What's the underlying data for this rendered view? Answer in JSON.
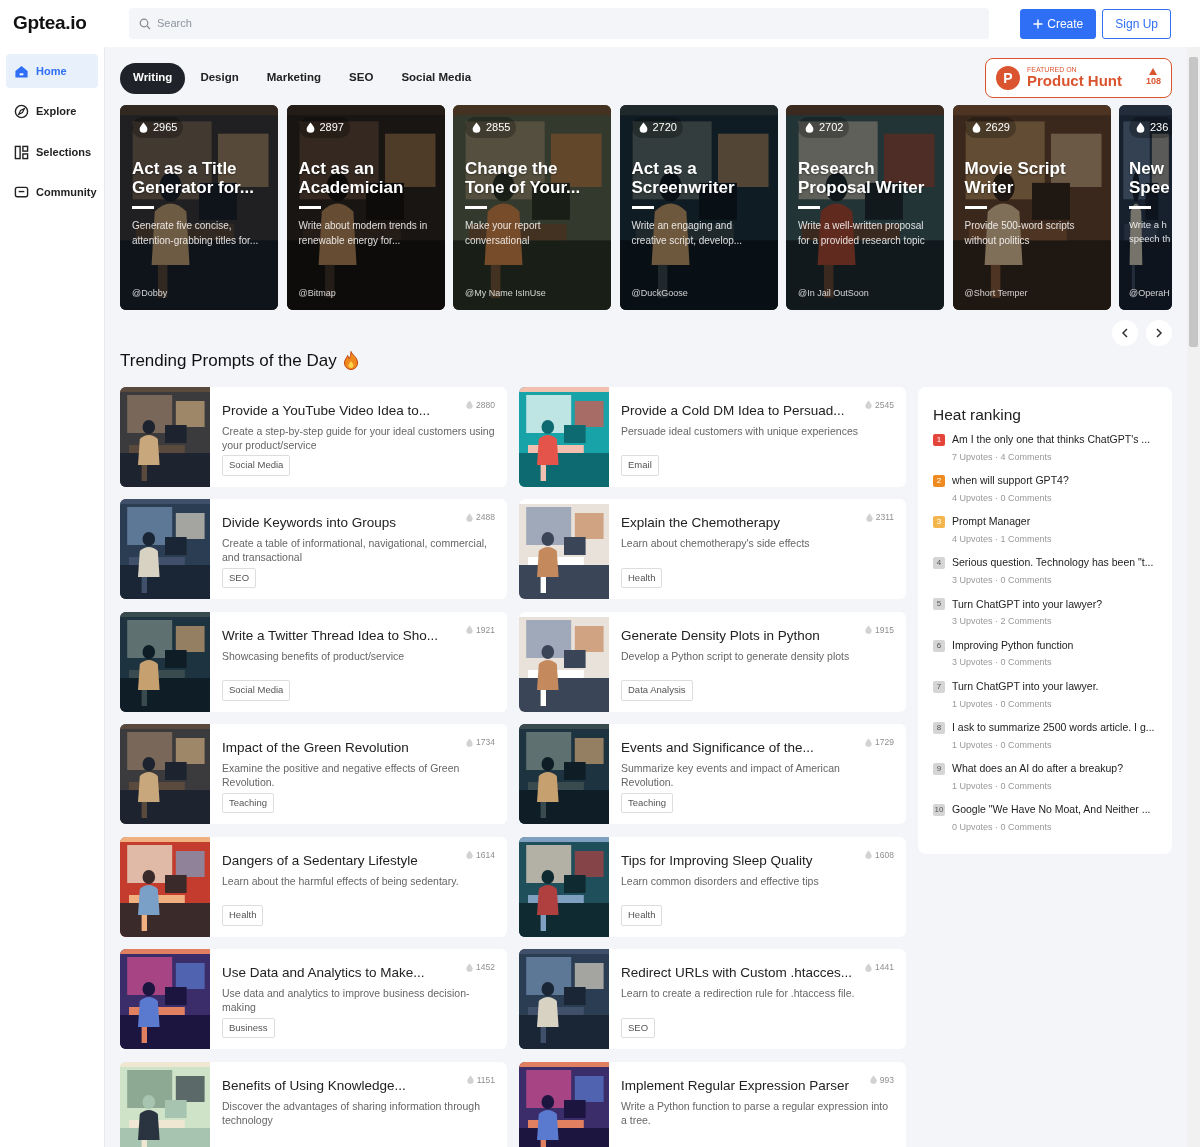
{
  "logo": "Gptea.io",
  "search": {
    "placeholder": "Search"
  },
  "header_buttons": [
    {
      "label": "Create",
      "kind": "primary"
    },
    {
      "label": "Sign Up",
      "kind": "outline"
    }
  ],
  "sidebar": {
    "items": [
      {
        "label": "Home",
        "selected": true
      },
      {
        "label": "Explore",
        "selected": false
      },
      {
        "label": "Selections",
        "selected": false
      },
      {
        "label": "Community",
        "selected": false
      }
    ]
  },
  "category_tabs": [
    {
      "label": "Writing",
      "selected": true
    },
    {
      "label": "Design",
      "selected": false
    },
    {
      "label": "Marketing",
      "selected": false
    },
    {
      "label": "SEO",
      "selected": false
    },
    {
      "label": "Social Media",
      "selected": false
    }
  ],
  "product_hunt": {
    "logo_letter": "P",
    "featured": "FEATURED ON",
    "name": "Product Hunt",
    "votes": "108"
  },
  "featured_cards": [
    {
      "count": "2965",
      "title": "Act as a Title Generator for...",
      "description": "Generate five concise, attention-grabbing titles for...",
      "author": "@Dobby"
    },
    {
      "count": "2897",
      "title": "Act as an Academician",
      "description": "Write about modern trends in renewable energy for...",
      "author": "@Bitmap"
    },
    {
      "count": "2855",
      "title": "Change the Tone of Your...",
      "description": "Make your report conversational",
      "author": "@My Name IsInUse"
    },
    {
      "count": "2720",
      "title": "Act as a Screenwriter",
      "description": "Write an engaging and creative script, develop...",
      "author": "@DuckGoose"
    },
    {
      "count": "2702",
      "title": "Research Proposal Writer",
      "description": "Write a well-written proposal for a provided research topic",
      "author": "@In Jail OutSoon"
    },
    {
      "count": "2629",
      "title": "Movie Script Writer",
      "description": "Provide 500-word scripts without politics",
      "author": "@Short Temper"
    },
    {
      "count": "236",
      "title": "New\nSpee",
      "description": "Write a h\nspeech th",
      "author": "@OperaH"
    }
  ],
  "section_title": "Trending Prompts of the Day",
  "prompts": [
    {
      "title": "Provide a YouTube Video Idea to...",
      "description": "Create a step-by-step guide for your ideal customers using your product/service",
      "tag": "Social Media",
      "count": "2880"
    },
    {
      "title": "Provide a Cold DM Idea to Persuad...",
      "description": "Persuade ideal customers with unique experiences",
      "tag": "Email",
      "count": "2545"
    },
    {
      "title": "Divide Keywords into Groups",
      "description": "Create a table of informational, navigational, commercial, and transactional",
      "tag": "SEO",
      "count": "2488"
    },
    {
      "title": "Explain the Chemotherapy",
      "description": "Learn about chemotherapy's side effects",
      "tag": "Health",
      "count": "2311"
    },
    {
      "title": "Write a Twitter Thread Idea to Sho...",
      "description": "Showcasing benefits of product/service",
      "tag": "Social Media",
      "count": "1921"
    },
    {
      "title": "Generate Density Plots in Python",
      "description": "Develop a Python script to generate density plots",
      "tag": "Data Analysis",
      "count": "1915"
    },
    {
      "title": "Impact of the Green Revolution",
      "description": "Examine the positive and negative effects of Green Revolution.",
      "tag": "Teaching",
      "count": "1734"
    },
    {
      "title": "Events and Significance of the...",
      "description": "Summarize key events and impact of American Revolution.",
      "tag": "Teaching",
      "count": "1729"
    },
    {
      "title": "Dangers of a Sedentary Lifestyle",
      "description": "Learn about the harmful effects of being sedentary.",
      "tag": "Health",
      "count": "1614"
    },
    {
      "title": "Tips for Improving Sleep Quality",
      "description": "Learn common disorders and effective tips",
      "tag": "Health",
      "count": "1608"
    },
    {
      "title": "Use Data and Analytics to Make...",
      "description": "Use data and analytics to improve business decision-making",
      "tag": "Business",
      "count": "1452"
    },
    {
      "title": "Redirect URLs with Custom .htacces...",
      "description": "Learn to create a redirection rule for .htaccess file.",
      "tag": "SEO",
      "count": "1441"
    },
    {
      "title": "Benefits of Using Knowledge...",
      "description": "Discover the advantages of sharing information through technology",
      "count": "1151"
    },
    {
      "title": "Implement Regular Expression Parser",
      "description": "Write a Python function to parse a regular expression into a tree.",
      "count": "993"
    }
  ],
  "heat_ranking": {
    "title": "Heat ranking",
    "items": [
      {
        "rank": "1",
        "color": "#e5443a",
        "title": "Am I the only one that thinks ChatGPT's ...",
        "meta": "7 Upvotes · 4 Comments"
      },
      {
        "rank": "2",
        "color": "#ef8a1f",
        "title": "when will support GPT4?",
        "meta": "4 Upvotes · 0 Comments"
      },
      {
        "rank": "3",
        "color": "#f4b64c",
        "title": "Prompt Manager",
        "meta": "4 Upvotes · 1 Comments"
      },
      {
        "rank": "4",
        "color": "#d5d5d5",
        "title": "Serious question. Technology has been \"t...",
        "meta": "3 Upvotes · 0 Comments"
      },
      {
        "rank": "5",
        "color": "#d5d5d5",
        "title": "Turn ChatGPT into your lawyer?",
        "meta": "3 Upvotes · 2 Comments"
      },
      {
        "rank": "6",
        "color": "#d5d5d5",
        "title": "Improving Python function",
        "meta": "3 Upvotes · 0 Comments"
      },
      {
        "rank": "7",
        "color": "#d5d5d5",
        "title": "Turn ChatGPT into your lawyer.",
        "meta": "1 Upvotes · 0 Comments"
      },
      {
        "rank": "8",
        "color": "#d5d5d5",
        "title": "I ask to summarize 2500 words article. I g...",
        "meta": "1 Upvotes · 0 Comments"
      },
      {
        "rank": "9",
        "color": "#d5d5d5",
        "title": "What does an AI do after a breakup?",
        "meta": "1 Upvotes · 0 Comments"
      },
      {
        "rank": "10",
        "color": "#d5d5d5",
        "title": "Google \"We Have No Moat, And Neither ...",
        "meta": "0 Upvotes · 0 Comments"
      }
    ]
  }
}
